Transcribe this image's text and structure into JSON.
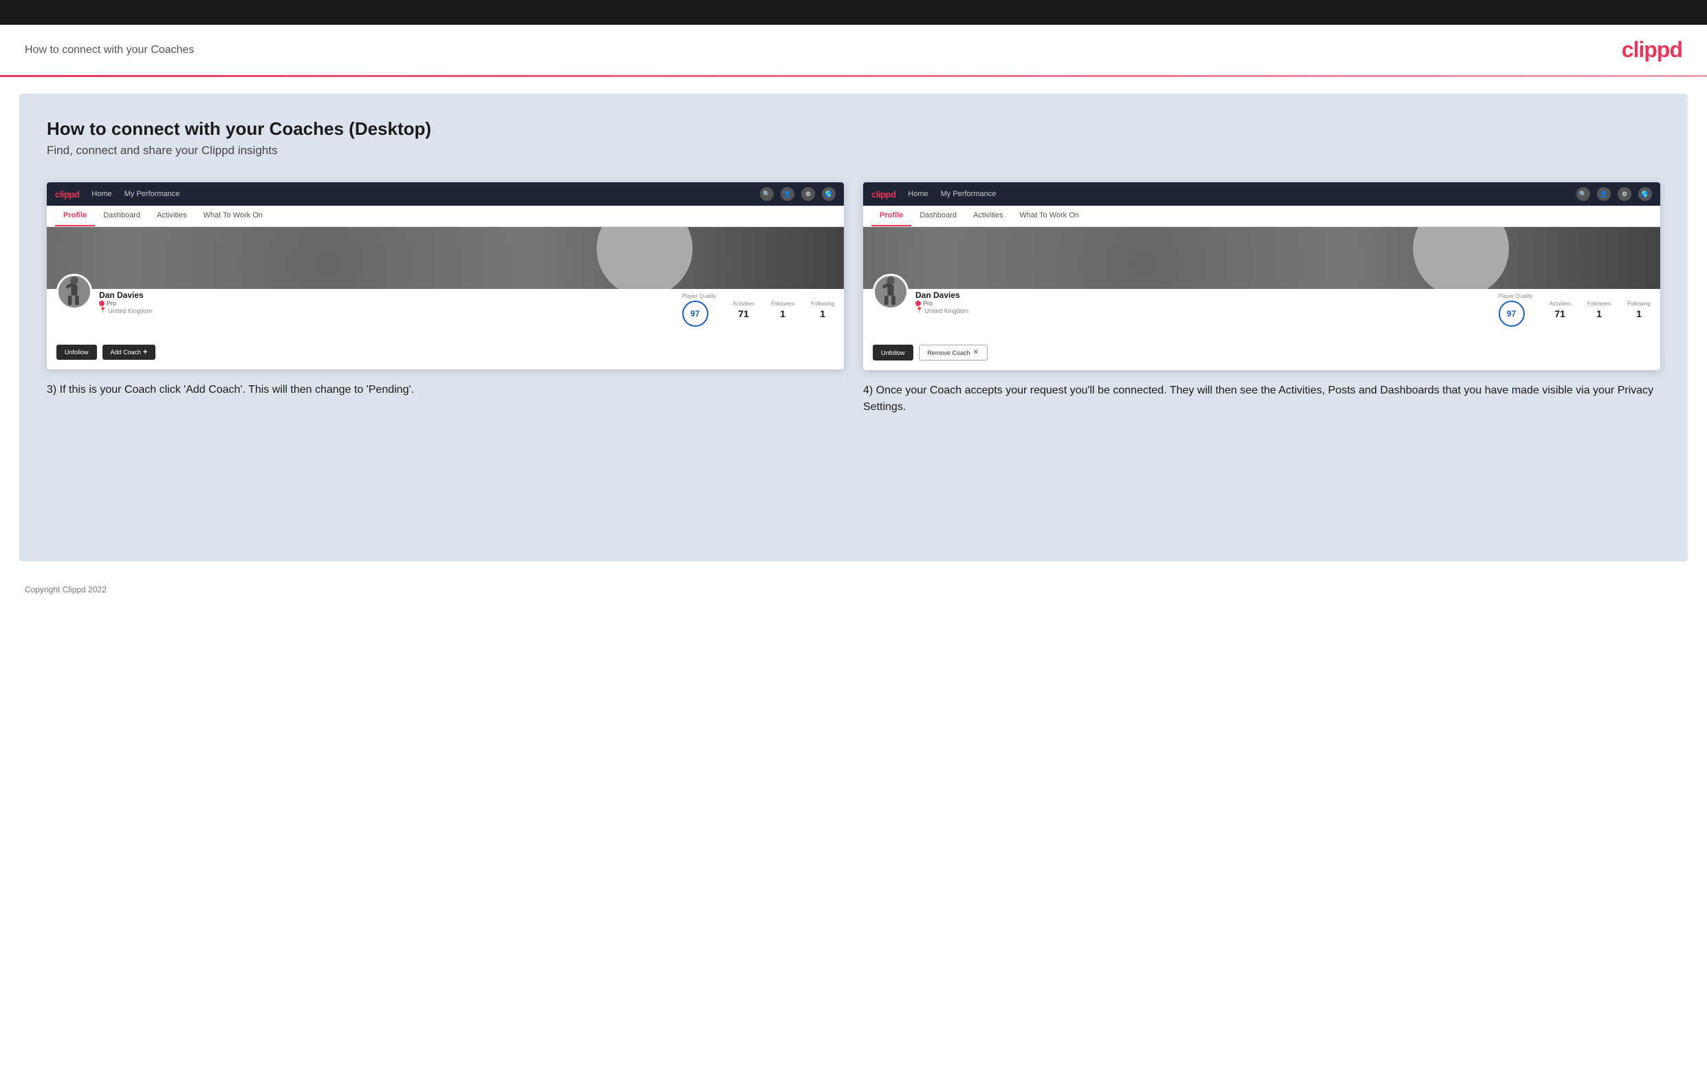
{
  "top_bar": {},
  "header": {
    "title": "How to connect with your Coaches",
    "logo": "clippd"
  },
  "main": {
    "title": "How to connect with your Coaches (Desktop)",
    "subtitle": "Find, connect and share your Clippd insights",
    "screenshot_left": {
      "nav": {
        "logo": "clippd",
        "items": [
          "Home",
          "My Performance"
        ],
        "icons": [
          "search",
          "person",
          "settings",
          "globe"
        ]
      },
      "tabs": [
        "Profile",
        "Dashboard",
        "Activities",
        "What To Work On"
      ],
      "active_tab": "Profile",
      "player": {
        "name": "Dan Davies",
        "role": "Pro",
        "location": "United Kingdom",
        "player_quality_label": "Player Quality",
        "player_quality": "97",
        "activities_label": "Activities",
        "activities": "71",
        "followers_label": "Followers",
        "followers": "1",
        "following_label": "Following",
        "following": "1"
      },
      "buttons": {
        "unfollow": "Unfollow",
        "add_coach": "Add Coach"
      }
    },
    "screenshot_right": {
      "nav": {
        "logo": "clippd",
        "items": [
          "Home",
          "My Performance"
        ],
        "icons": [
          "search",
          "person",
          "settings",
          "globe"
        ]
      },
      "tabs": [
        "Profile",
        "Dashboard",
        "Activities",
        "What To Work On"
      ],
      "active_tab": "Profile",
      "player": {
        "name": "Dan Davies",
        "role": "Pro",
        "location": "United Kingdom",
        "player_quality_label": "Player Quality",
        "player_quality": "97",
        "activities_label": "Activities",
        "activities": "71",
        "followers_label": "Followers",
        "followers": "1",
        "following_label": "Following",
        "following": "1"
      },
      "buttons": {
        "unfollow": "Unfollow",
        "remove_coach": "Remove Coach"
      }
    },
    "caption_left": "3) If this is your Coach click 'Add Coach'. This will then change to 'Pending'.",
    "caption_right": "4) Once your Coach accepts your request you'll be connected. They will then see the Activities, Posts and Dashboards that you have made visible via your Privacy Settings."
  },
  "footer": {
    "copyright": "Copyright Clippd 2022"
  }
}
